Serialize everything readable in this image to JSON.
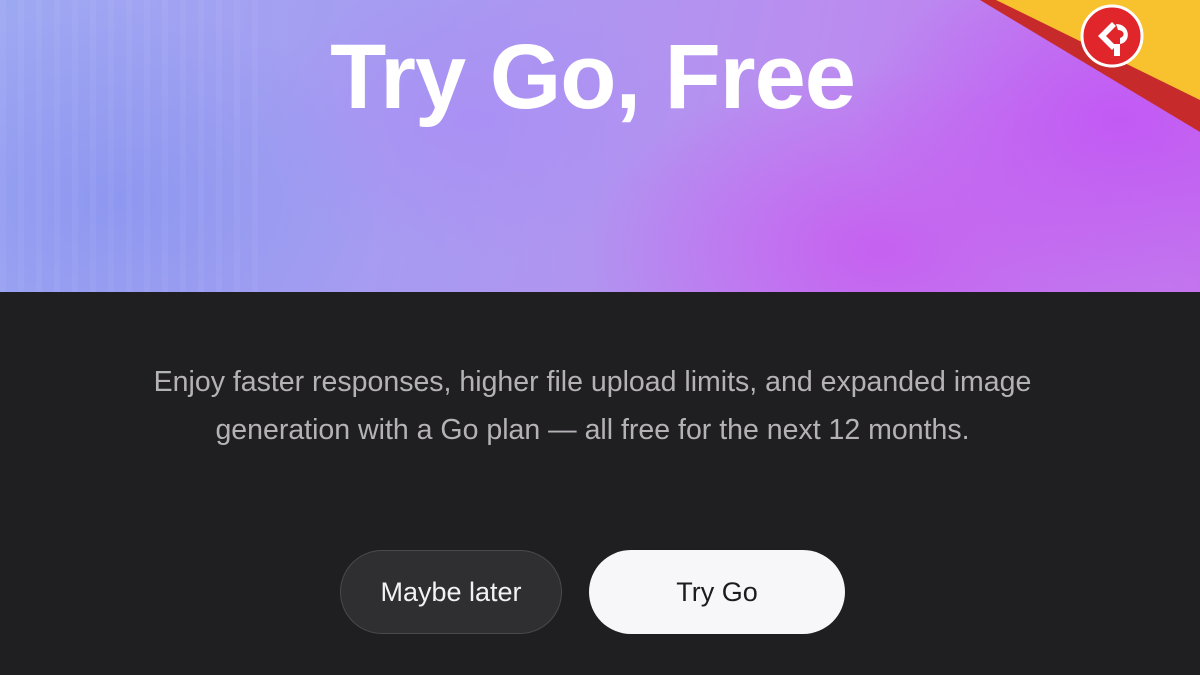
{
  "hero": {
    "title": "Try Go, Free"
  },
  "promo": {
    "description": "Enjoy faster responses, higher file upload limits, and expanded image generation with a Go plan — all free for the next 12 months."
  },
  "actions": {
    "secondary_label": "Maybe later",
    "primary_label": "Try Go"
  },
  "corner_badge": {
    "icon": "brand-logo-icon",
    "colors": {
      "stripe": "#f7c22e",
      "band": "#c62a2a",
      "disc": "#e0252b"
    }
  },
  "colors": {
    "background": "#1f1e20",
    "hero_gradient_start": "#9da8f2",
    "hero_gradient_end": "#c373ee",
    "primary_button": "#f7f6f8",
    "secondary_button": "#2f2e30"
  }
}
